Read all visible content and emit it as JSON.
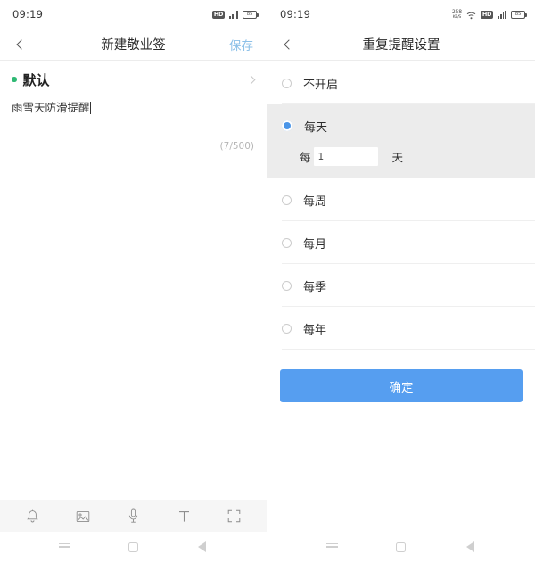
{
  "left": {
    "status": {
      "time": "09:19",
      "icons": [
        "hd-icon",
        "signal-icon",
        "battery-icon"
      ],
      "battery_level": "85"
    },
    "appbar": {
      "back_icon": "chevron-left-icon",
      "title": "新建敬业签",
      "action_label": "保存",
      "action_color": "#8cc0e8"
    },
    "note": {
      "category_label": "默认",
      "category_dot_color": "#2fb974",
      "chevron_icon": "chevron-right-icon",
      "content": "雨雪天防滑提醒",
      "char_count": "(7/500)"
    },
    "toolbar": {
      "items": [
        {
          "name": "reminder-bell-icon",
          "label": "提醒"
        },
        {
          "name": "image-icon",
          "label": "图片"
        },
        {
          "name": "microphone-icon",
          "label": "录音"
        },
        {
          "name": "text-format-icon",
          "label": "文字"
        },
        {
          "name": "fullscreen-icon",
          "label": "全屏"
        }
      ]
    }
  },
  "right": {
    "status": {
      "time": "09:19",
      "net_speed_value": "258",
      "net_speed_unit": "KB/S",
      "icons": [
        "wifi-icon",
        "hd-icon",
        "signal-icon",
        "battery-icon"
      ],
      "battery_level": "85"
    },
    "appbar": {
      "back_icon": "chevron-left-icon",
      "title": "重复提醒设置"
    },
    "options": [
      {
        "label": "不开启",
        "selected": false
      },
      {
        "label": "每天",
        "selected": true
      },
      {
        "label": "每周",
        "selected": false
      },
      {
        "label": "每月",
        "selected": false
      },
      {
        "label": "每季",
        "selected": false
      },
      {
        "label": "每年",
        "selected": false
      }
    ],
    "interval": {
      "prefix": "每",
      "value": "1",
      "suffix": "天"
    },
    "confirm_label": "确定",
    "accent_color": "#4a95e8",
    "button_color": "#569ef0"
  },
  "navbar": {
    "recents_icon": "recents-menu-icon",
    "home_icon": "home-square-icon",
    "back_icon": "back-triangle-icon"
  }
}
